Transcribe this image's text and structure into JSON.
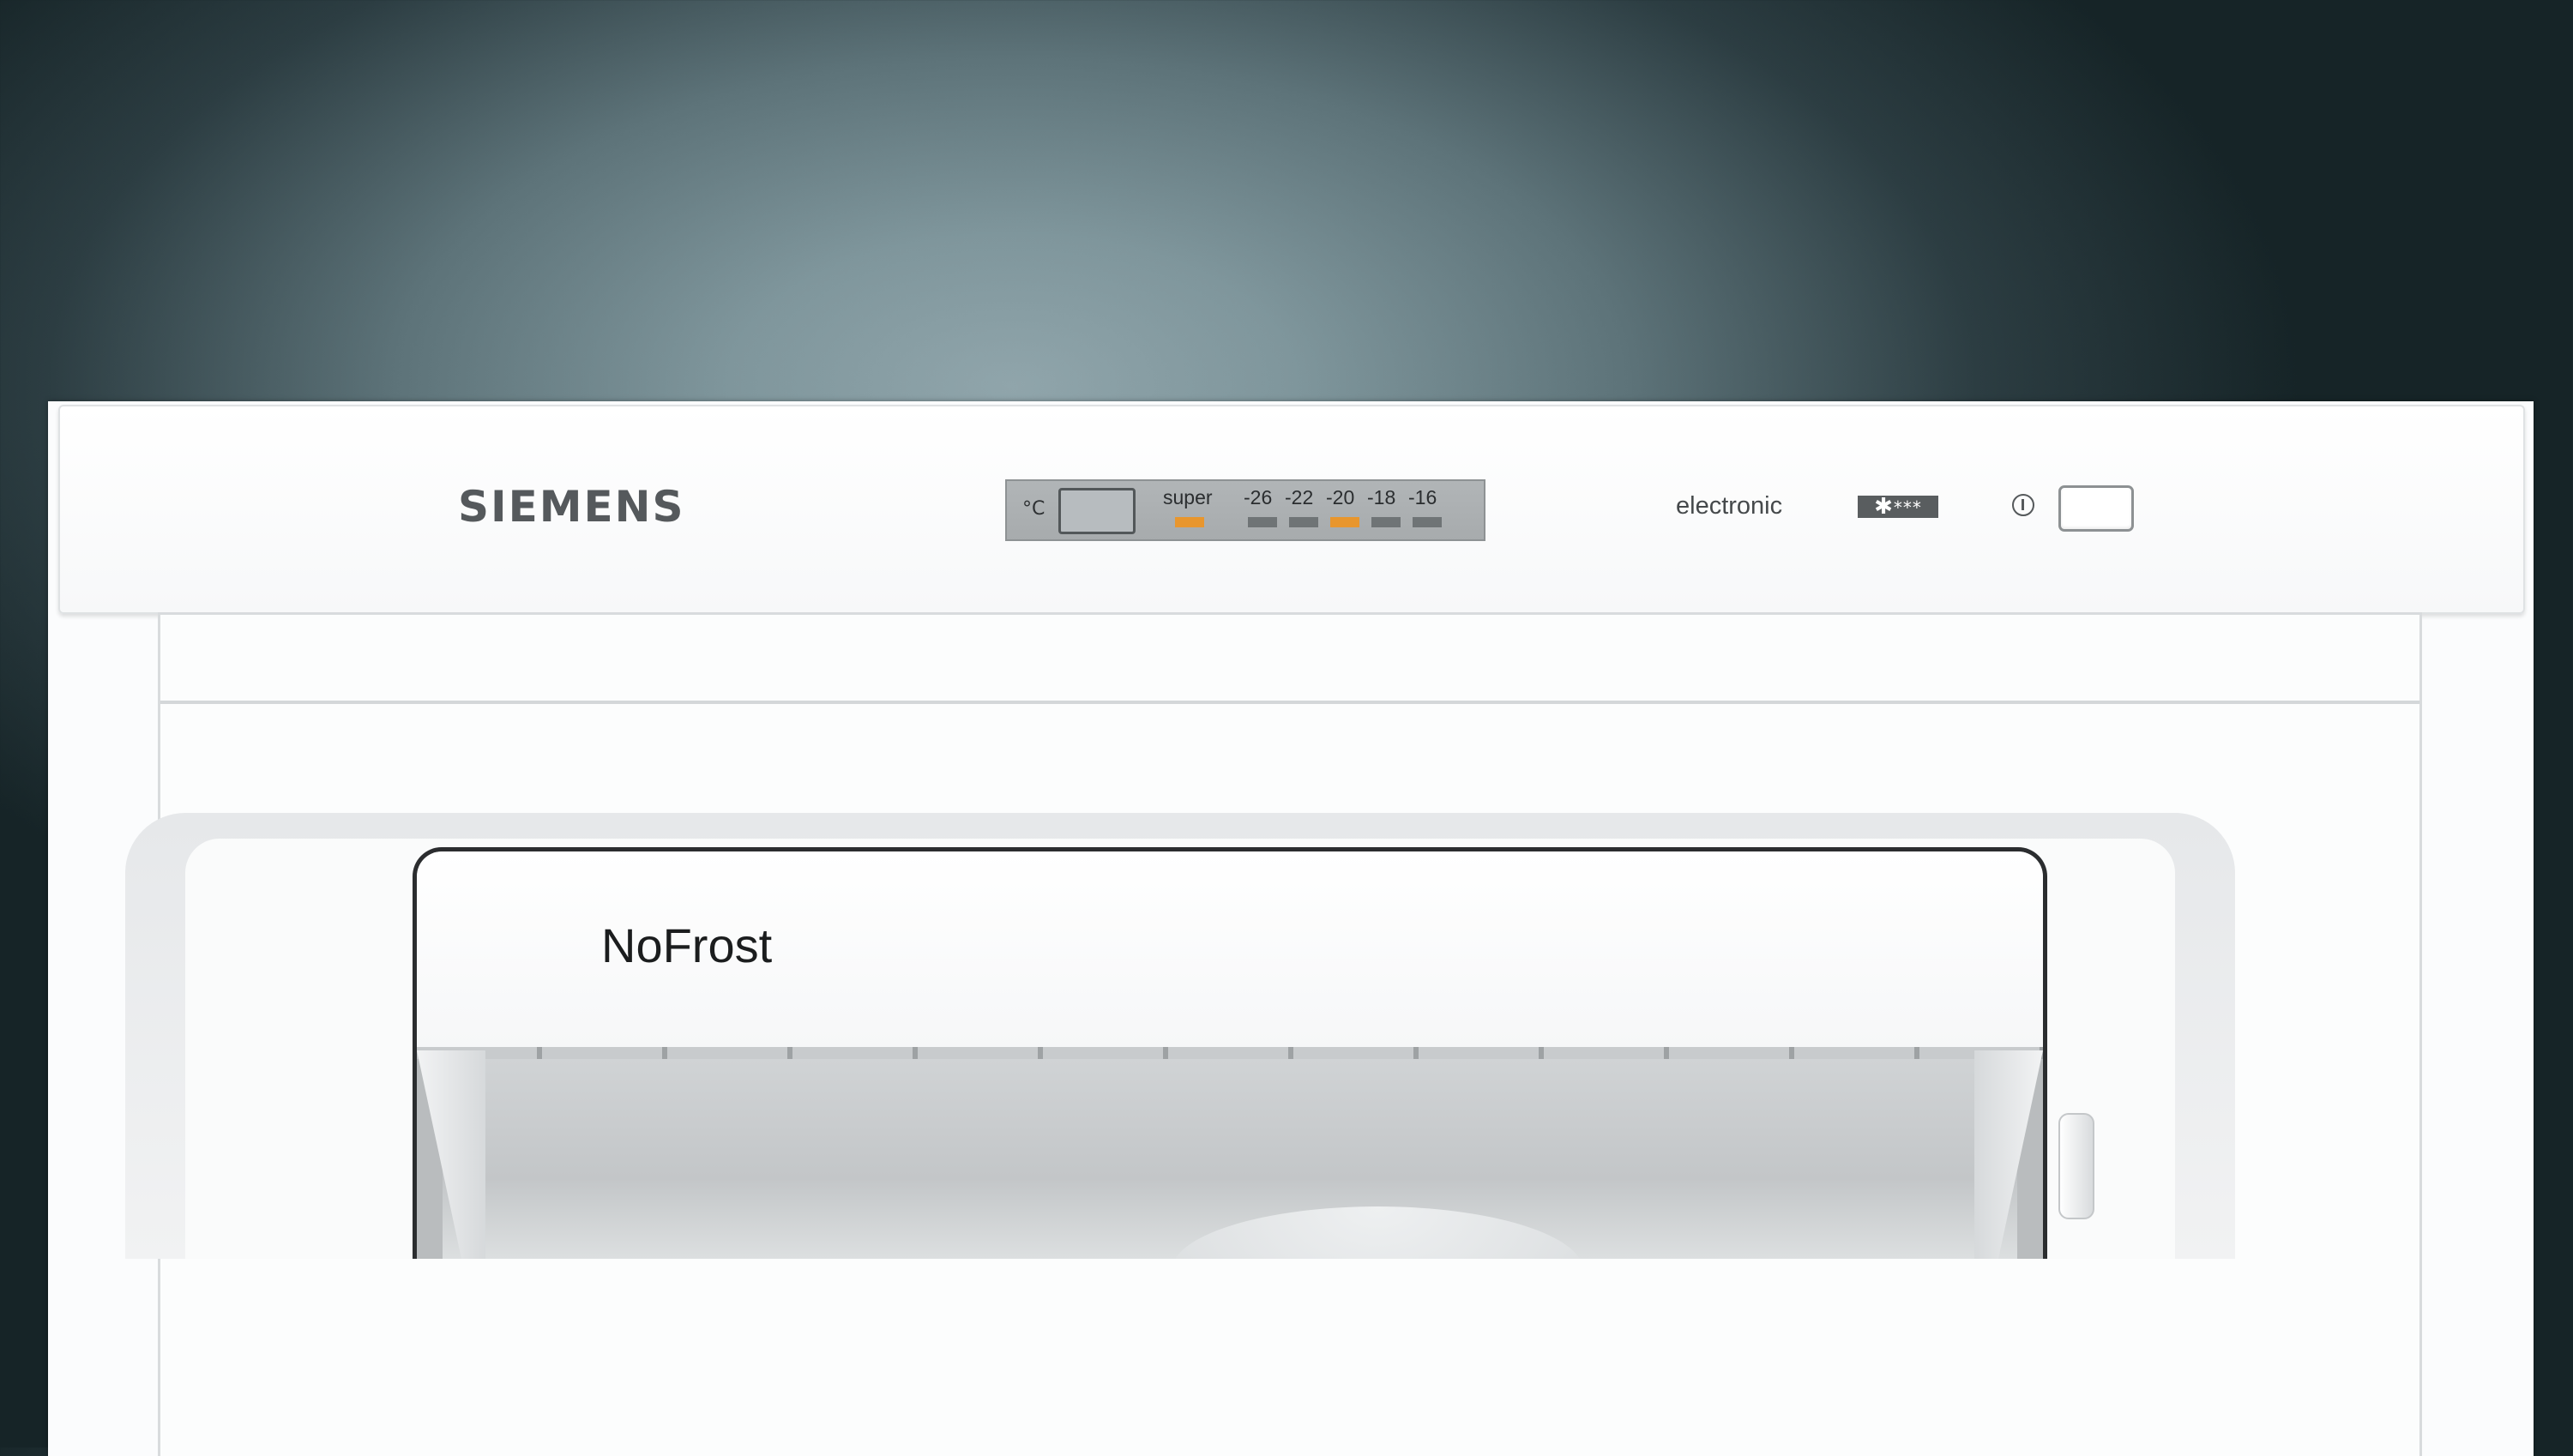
{
  "control_panel": {
    "brand": "SIEMENS",
    "display": {
      "unit": "°C",
      "super_label": "super",
      "temperatures": [
        "-26",
        "-22",
        "-20",
        "-18",
        "-16"
      ],
      "super_active": true,
      "active_temperature": "-20"
    },
    "mode_label": "electronic",
    "star_rating": {
      "symbol": "✱",
      "stars": "***"
    },
    "power_icon": "power-symbol"
  },
  "drawer": {
    "label": "NoFrost"
  },
  "colors": {
    "led_active": "#e8962e",
    "led_inactive": "#6f7476",
    "display_bg": "#aeb2b4"
  }
}
